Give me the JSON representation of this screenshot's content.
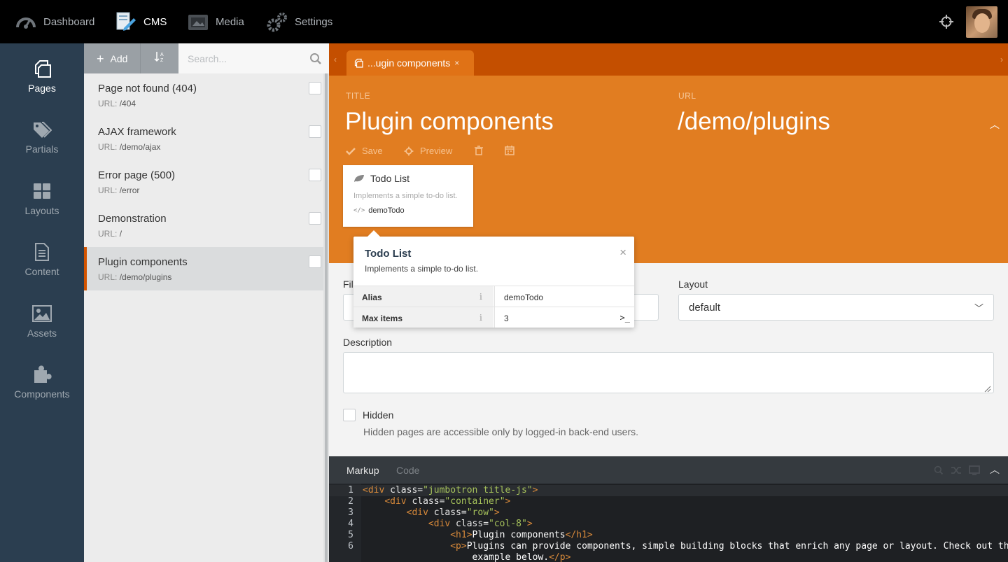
{
  "topnav": {
    "items": [
      {
        "label": "Dashboard",
        "icon": "speedometer-icon"
      },
      {
        "label": "CMS",
        "icon": "cms-icon",
        "active": true
      },
      {
        "label": "Media",
        "icon": "media-icon"
      },
      {
        "label": "Settings",
        "icon": "gears-icon"
      }
    ]
  },
  "sidebar": {
    "items": [
      {
        "label": "Pages",
        "icon": "pages-icon",
        "active": true
      },
      {
        "label": "Partials",
        "icon": "tags-icon"
      },
      {
        "label": "Layouts",
        "icon": "layouts-grid-icon"
      },
      {
        "label": "Content",
        "icon": "document-icon"
      },
      {
        "label": "Assets",
        "icon": "image-icon"
      },
      {
        "label": "Components",
        "icon": "puzzle-icon"
      }
    ]
  },
  "list": {
    "add_label": "Add",
    "search_placeholder": "Search...",
    "url_key": "URL:",
    "items": [
      {
        "title": "Page not found (404)",
        "url": "/404"
      },
      {
        "title": "AJAX framework",
        "url": "/demo/ajax"
      },
      {
        "title": "Error page (500)",
        "url": "/error"
      },
      {
        "title": "Demonstration",
        "url": "/"
      },
      {
        "title": "Plugin components",
        "url": "/demo/plugins",
        "active": true
      }
    ]
  },
  "editor_tab": {
    "label": "...ugin components",
    "close": "×"
  },
  "header": {
    "title_label": "TITLE",
    "title_value": "Plugin components",
    "url_label": "URL",
    "url_value": "/demo/plugins",
    "save_label": "Save",
    "preview_label": "Preview"
  },
  "component": {
    "name": "Todo List",
    "description": "Implements a simple to-do list.",
    "alias": "demoTodo"
  },
  "inspector": {
    "title": "Todo List",
    "description": "Implements a simple to-do list.",
    "close": "×",
    "rows": [
      {
        "key": "Alias",
        "value": "demoTodo"
      },
      {
        "key": "Max items",
        "value": "3"
      }
    ],
    "info_glyph": "i",
    "terminal_glyph": ">_"
  },
  "form": {
    "file_label": "Fil",
    "layout_label": "Layout",
    "layout_value": "default",
    "description_label": "Description",
    "hidden_label": "Hidden",
    "hidden_help": "Hidden pages are accessible only by logged-in back-end users."
  },
  "editor": {
    "tabs": [
      "Markup",
      "Code"
    ],
    "lines": [
      {
        "n": "1",
        "code": "<div class=\"jumbotron title-js\">"
      },
      {
        "n": "2",
        "code": "    <div class=\"container\">"
      },
      {
        "n": "3",
        "code": "        <div class=\"row\">"
      },
      {
        "n": "4",
        "code": "            <div class=\"col-8\">"
      },
      {
        "n": "5",
        "code": "                <h1>Plugin components</h1>"
      },
      {
        "n": "6",
        "code": "                <p>Plugins can provide components, simple building blocks that enrich any page or layout. Check out the todo"
      },
      {
        "n": "",
        "code": "                    example below.</p>"
      }
    ]
  },
  "colors": {
    "accent": "#e17d21",
    "tabstrip": "#c44f00",
    "sidebar": "#2b3e50"
  }
}
